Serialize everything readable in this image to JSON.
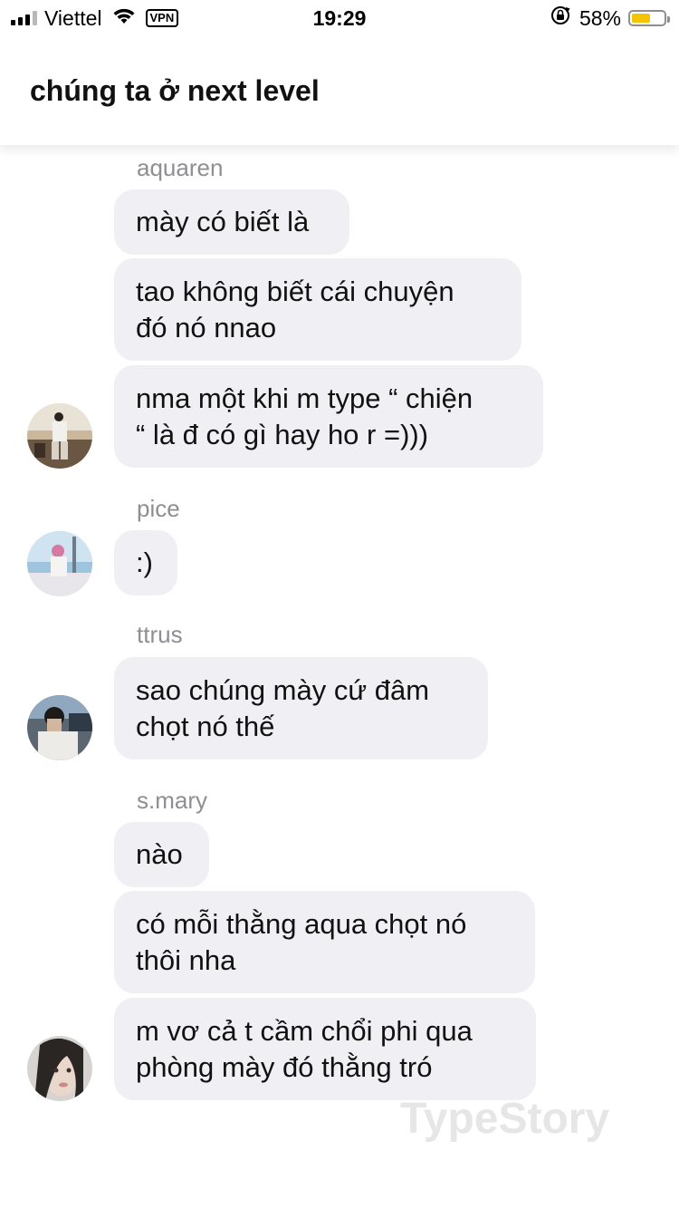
{
  "status_bar": {
    "carrier": "Viettel",
    "vpn": "VPN",
    "time": "19:29",
    "battery_percent": "58%",
    "battery_level": 0.58,
    "icons": [
      "signal-icon",
      "wifi-icon",
      "orientation-lock-icon",
      "battery-icon"
    ]
  },
  "header": {
    "title": "chúng ta ở next level"
  },
  "messages": [
    {
      "sender": "aquaren",
      "texts": [
        "mày có biết là",
        "tao không biết cái chuyện\nđó nó nnao",
        "nma một khi m type “ chiện\n“ là đ có gì hay ho r =)))"
      ]
    },
    {
      "sender": "pice",
      "texts": [
        ":)"
      ]
    },
    {
      "sender": "ttrus",
      "texts": [
        "sao chúng mày cứ đâm\nchọt nó thế"
      ]
    },
    {
      "sender": "s.mary",
      "texts": [
        "nào",
        "có mỗi thằng aqua chọt nó\nthôi nha",
        "m vơ cả t cầm chổi phi qua\nphòng mày đó thằng tró"
      ]
    }
  ],
  "watermark": "TypeStory",
  "colors": {
    "bubble": "#efeff4",
    "sender_name": "#8e8e93",
    "battery": "#f5c400"
  }
}
